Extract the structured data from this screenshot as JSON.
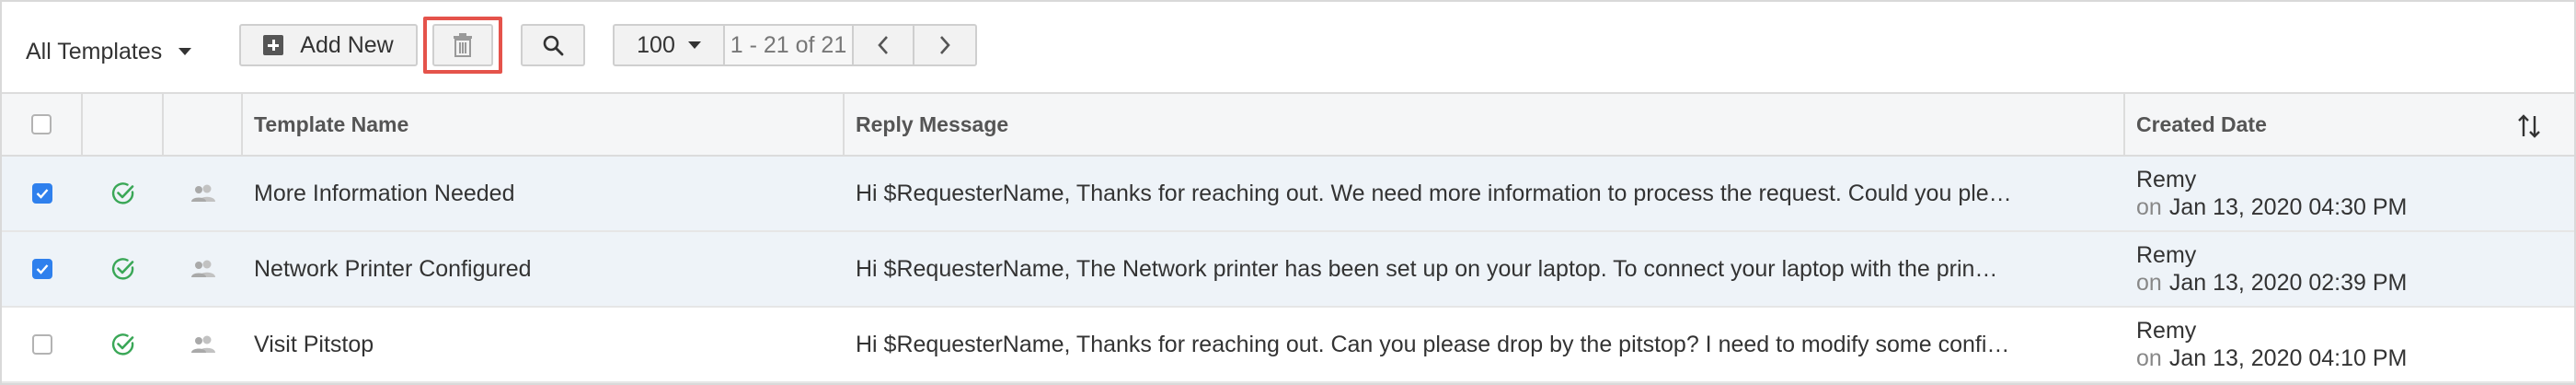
{
  "toolbar": {
    "filter_label": "All Templates",
    "add_label": "Add New",
    "page_size": "100",
    "range_text": "1 - 21 of 21"
  },
  "columns": {
    "name": "Template Name",
    "message": "Reply Message",
    "created": "Created Date"
  },
  "rows": [
    {
      "checked": true,
      "name": "More Information Needed",
      "message": "Hi $RequesterName, Thanks for reaching out. We need more information to process the request. Could you ple…",
      "created_by": "Remy",
      "on_label": "on",
      "created_at": "Jan 13, 2020 04:30 PM"
    },
    {
      "checked": true,
      "name": "Network Printer Configured",
      "message": "Hi $RequesterName, The Network printer has been set up on your laptop. To connect your laptop with the prin…",
      "created_by": "Remy",
      "on_label": "on",
      "created_at": "Jan 13, 2020 02:39 PM"
    },
    {
      "checked": false,
      "name": "Visit Pitstop",
      "message": "Hi $RequesterName, Thanks for reaching out. Can you please drop by the pitstop? I need to modify some confi…",
      "created_by": "Remy",
      "on_label": "on",
      "created_at": "Jan 13, 2020 04:10 PM"
    }
  ],
  "colors": {
    "accent_blue": "#2f80ed",
    "status_green": "#3aa757",
    "highlight_red": "#e5534b",
    "selected_row": "#eef3f8"
  },
  "icons": {
    "add": "plus-square-icon",
    "delete": "trash-icon",
    "search": "search-icon",
    "prev": "chevron-left-icon",
    "next": "chevron-right-icon",
    "sort": "sort-icon",
    "status": "check-circle-icon",
    "shared": "group-icon"
  }
}
